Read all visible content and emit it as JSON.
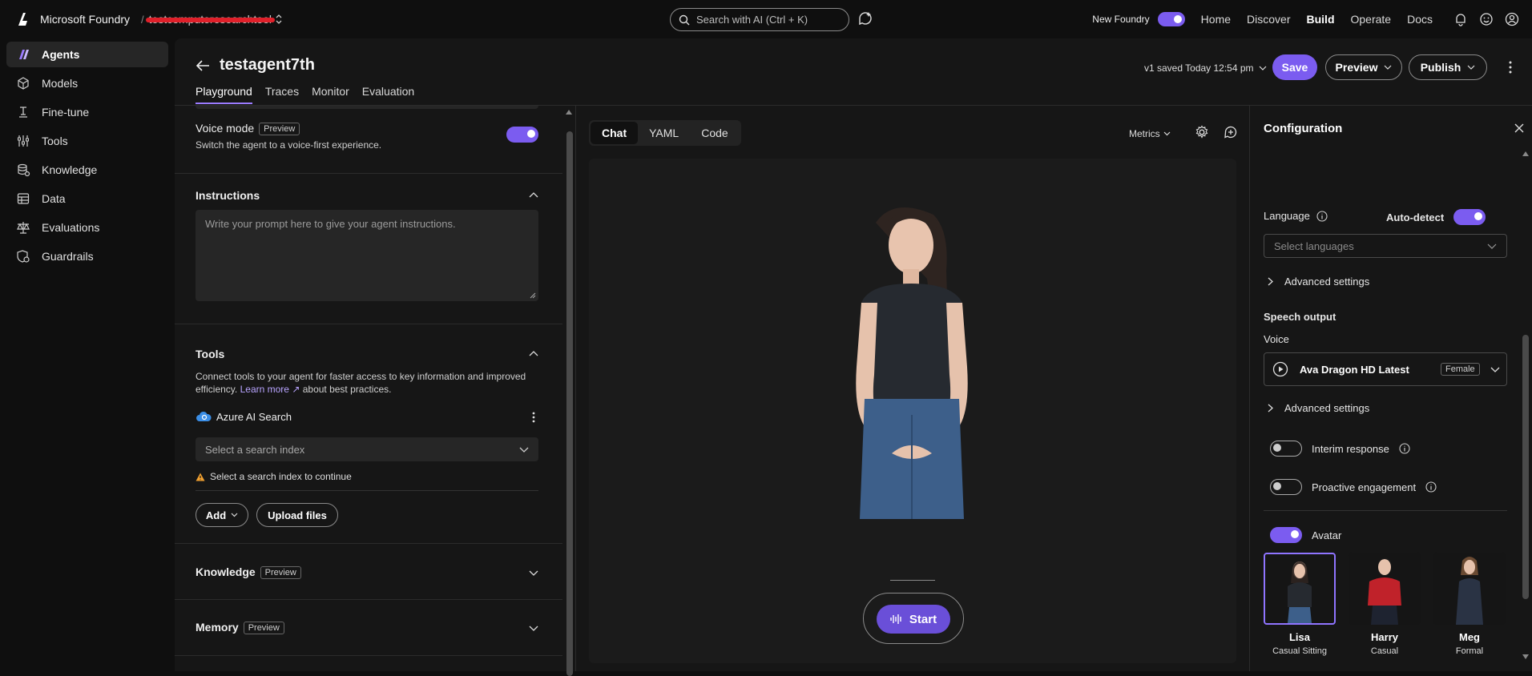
{
  "topbar": {
    "brand": "Microsoft Foundry",
    "separator": "/",
    "project": "testcomputeresearchtool",
    "search_placeholder": "Search with AI (Ctrl + K)",
    "new_foundry_label": "New Foundry",
    "nav": [
      "Home",
      "Discover",
      "Build",
      "Operate",
      "Docs"
    ],
    "active_nav": "Build"
  },
  "sidebar": {
    "items": [
      {
        "label": "Agents",
        "icon": "agents-icon"
      },
      {
        "label": "Models",
        "icon": "models-icon"
      },
      {
        "label": "Fine-tune",
        "icon": "fine-tune-icon"
      },
      {
        "label": "Tools",
        "icon": "tools-icon"
      },
      {
        "label": "Knowledge",
        "icon": "knowledge-icon"
      },
      {
        "label": "Data",
        "icon": "data-icon"
      },
      {
        "label": "Evaluations",
        "icon": "evaluations-icon"
      },
      {
        "label": "Guardrails",
        "icon": "guardrails-icon"
      }
    ],
    "active": "Agents"
  },
  "header": {
    "title": "testagent7th",
    "tabs": [
      "Playground",
      "Traces",
      "Monitor",
      "Evaluation"
    ],
    "active_tab": "Playground",
    "saved_info": "v1 saved Today 12:54 pm",
    "save_label": "Save",
    "preview_label": "Preview",
    "publish_label": "Publish"
  },
  "left": {
    "voice_mode": {
      "title": "Voice mode",
      "badge": "Preview",
      "desc": "Switch the agent to a voice-first experience.",
      "on": true
    },
    "instructions": {
      "title": "Instructions",
      "placeholder": "Write your prompt here to give your agent instructions."
    },
    "tools": {
      "title": "Tools",
      "desc_a": "Connect tools to your agent for faster access to key information and improved",
      "desc_b": "efficiency.",
      "learn_more": "Learn more",
      "desc_c": "about best practices.",
      "tool_name": "Azure AI Search",
      "select_placeholder": "Select a search index",
      "warning": "Select a search index to continue",
      "add_label": "Add",
      "upload_label": "Upload files"
    },
    "knowledge": {
      "title": "Knowledge",
      "badge": "Preview"
    },
    "memory": {
      "title": "Memory",
      "badge": "Preview"
    }
  },
  "center": {
    "tabs": [
      "Chat",
      "YAML",
      "Code"
    ],
    "active_tab": "Chat",
    "metrics_label": "Metrics",
    "start_label": "Start"
  },
  "config": {
    "title": "Configuration",
    "language_label": "Language",
    "auto_detect_label": "Auto-detect",
    "auto_detect_on": true,
    "languages_placeholder": "Select languages",
    "advanced_settings_1": "Advanced settings",
    "speech_output_label": "Speech output",
    "voice_label": "Voice",
    "voice_name": "Ava Dragon HD Latest",
    "voice_gender": "Female",
    "advanced_settings_2": "Advanced settings",
    "interim_response_label": "Interim response",
    "interim_on": false,
    "proactive_label": "Proactive engagement",
    "proactive_on": false,
    "avatar_label": "Avatar",
    "avatar_on": true,
    "avatars": [
      {
        "name": "Lisa",
        "style": "Casual Sitting",
        "selected": true
      },
      {
        "name": "Harry",
        "style": "Casual",
        "selected": false
      },
      {
        "name": "Meg",
        "style": "Formal",
        "selected": false
      }
    ]
  },
  "colors": {
    "accent": "#7b5cf0",
    "background": "#161616",
    "warning": "#f0a030"
  }
}
